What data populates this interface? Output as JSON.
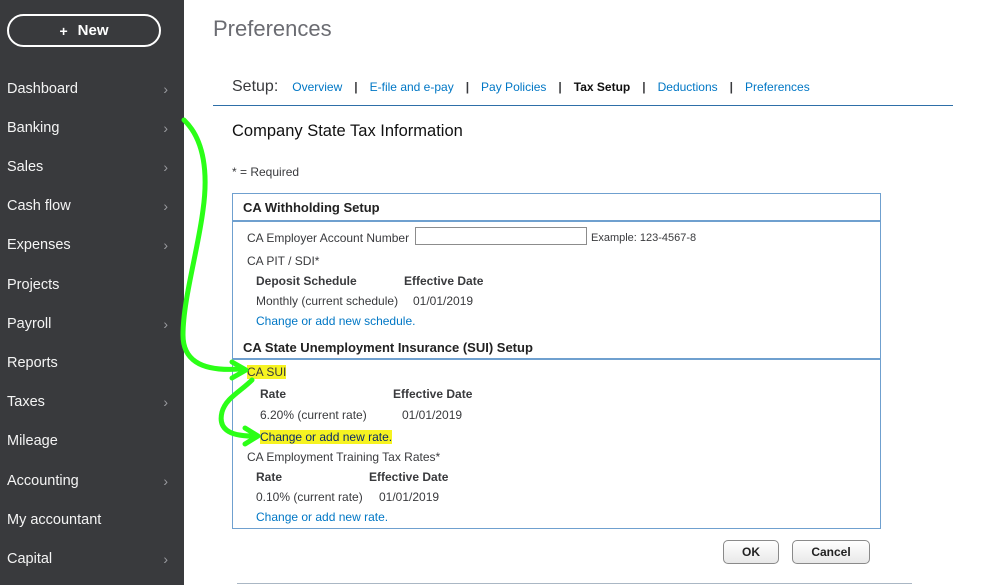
{
  "sidebar": {
    "new_button": {
      "icon": "plus-icon",
      "label": "New"
    },
    "items": [
      {
        "label": "Dashboard",
        "has_chevron": true
      },
      {
        "label": "Banking",
        "has_chevron": true
      },
      {
        "label": "Sales",
        "has_chevron": true
      },
      {
        "label": "Cash flow",
        "has_chevron": true
      },
      {
        "label": "Expenses",
        "has_chevron": true
      },
      {
        "label": "Projects",
        "has_chevron": false
      },
      {
        "label": "Payroll",
        "has_chevron": true
      },
      {
        "label": "Reports",
        "has_chevron": false
      },
      {
        "label": "Taxes",
        "has_chevron": true
      },
      {
        "label": "Mileage",
        "has_chevron": false
      },
      {
        "label": "Accounting",
        "has_chevron": true
      },
      {
        "label": "My accountant",
        "has_chevron": false
      },
      {
        "label": "Capital",
        "has_chevron": true
      }
    ]
  },
  "page": {
    "title": "Preferences"
  },
  "setup_nav": {
    "label": "Setup:",
    "links": [
      {
        "label": "Overview",
        "active": false
      },
      {
        "label": "E-file and e-pay",
        "active": false
      },
      {
        "label": "Pay Policies",
        "active": false
      },
      {
        "label": "Tax Setup",
        "active": true
      },
      {
        "label": "Deductions",
        "active": false
      },
      {
        "label": "Preferences",
        "active": false
      }
    ],
    "separator": "|"
  },
  "section": {
    "title": "Company State Tax Information",
    "required_note": "* = Required"
  },
  "withholding": {
    "header": "CA Withholding Setup",
    "account_label": "CA Employer Account Number",
    "account_value": "",
    "account_example": "Example: 123-4567-8",
    "pit_label": "CA PIT / SDI*",
    "col_schedule": "Deposit Schedule",
    "col_effective": "Effective Date",
    "schedule_value": "Monthly (current schedule)",
    "schedule_date": "01/01/2019",
    "change_link": "Change or add new schedule."
  },
  "sui": {
    "header": "CA State Unemployment Insurance (SUI) Setup",
    "sui_label": "CA SUI",
    "col_rate": "Rate",
    "col_effective": "Effective Date",
    "rate_value": "6.20% (current rate)",
    "rate_date": "01/01/2019",
    "change_link": "Change or add new rate.",
    "ett_label": "CA Employment Training Tax Rates*",
    "ett_col_rate": "Rate",
    "ett_col_effective": "Effective Date",
    "ett_rate_value": "0.10% (current rate)",
    "ett_rate_date": "01/01/2019",
    "ett_change_link": "Change or add new rate."
  },
  "actions": {
    "ok": "OK",
    "cancel": "Cancel"
  },
  "colors": {
    "sidebar_bg": "#393a3d",
    "link": "#0077c5",
    "highlight": "#f6f321",
    "annotation": "#2bff17",
    "box_border": "#6fa0cf"
  }
}
